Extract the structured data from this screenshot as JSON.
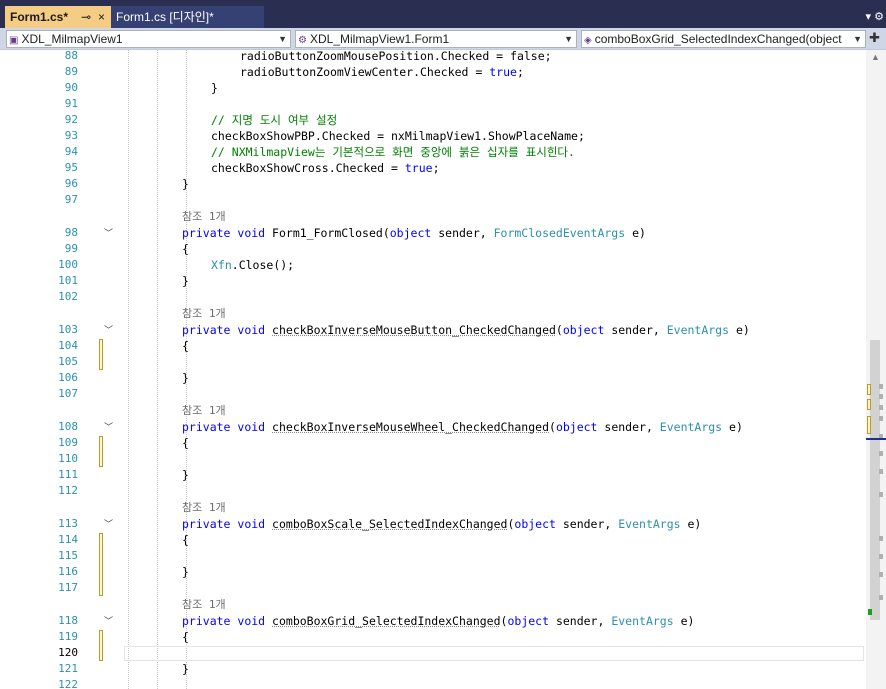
{
  "tabs": [
    {
      "name": "Form1.cs*",
      "pin": "⊸",
      "close": "×"
    },
    {
      "name": "Form1.cs [디자인]*"
    }
  ],
  "tabbar_menu": "▾ ⚙",
  "nav": {
    "project": "XDL_MilmapView1",
    "class": "XDL_MilmapView1.Form1",
    "member": "comboBoxGrid_SelectedIndexChanged(object",
    "split": "✚"
  },
  "editor": {
    "current_line": "120",
    "line_numbers": [
      "88",
      "89",
      "90",
      "91",
      "92",
      "93",
      "94",
      "95",
      "96",
      "97",
      "98",
      "99",
      "100",
      "101",
      "102",
      "103",
      "104",
      "105",
      "106",
      "107",
      "108",
      "109",
      "110",
      "111",
      "112",
      "113",
      "114",
      "115",
      "116",
      "117",
      "118",
      "119",
      "120",
      "121",
      "122"
    ],
    "ref_label": "참조 1개",
    "lines": {
      "l88": "radioButtonZoomMousePosition.Checked = false;",
      "l89_a": "radioButtonZoomViewCenter.Checked = ",
      "l89_kw": "true",
      "l89_b": ";",
      "l90": "}",
      "l92": "// 지명 도시 여부 설정",
      "l93": "checkBoxShowPBP.Checked = nxMilmapView1.ShowPlaceName;",
      "l94": "// NXMilmapView는 기본적으로 화면 중앙에 붉은 십자를 표시힌다.",
      "l95_a": "checkBoxShowCross.Checked = ",
      "l95_kw": "true",
      "l95_b": ";",
      "close_brace": "}",
      "open_brace": "{",
      "private": "private",
      "void": "void",
      "object": "object",
      "m98_name": "Form1_FormClosed(",
      "m98_type": "FormClosedEventArgs",
      "m98_end": " e)",
      "sender": " sender, ",
      "l100_type": "Xfn",
      "l100_b": ".Close();",
      "m103_name": "checkBoxInverseMouseButton_CheckedChanged",
      "m108_name": "checkBoxInverseMouseWheel_CheckedChanged",
      "m113_name": "comboBoxScale_SelectedIndexChanged",
      "m118_name": "comboBoxGrid_SelectedIndexChanged",
      "paren": "(",
      "event_args": "EventArgs",
      "end_e": " e)"
    }
  },
  "colors": {
    "keyword": "#0000ff",
    "type": "#2b91af",
    "comment": "#008000",
    "tab_active": "#f5cc84",
    "tabbar": "#2a2f52"
  },
  "icons": [
    "pin-icon",
    "close-icon",
    "csharp-project-icon",
    "class-icon",
    "method-icon",
    "chevron-down-icon",
    "split-icon",
    "collapse-icon"
  ]
}
